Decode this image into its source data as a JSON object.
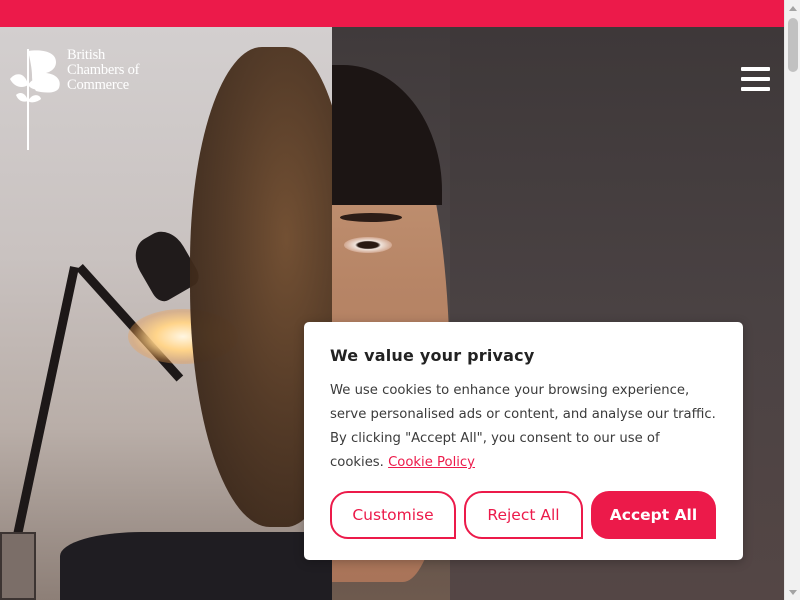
{
  "brand": {
    "name_line1": "British",
    "name_line2": "Chambers of",
    "name_line3": "Commerce",
    "accent_color": "#ec1a4a"
  },
  "header": {
    "menu_icon": "hamburger-menu-icon"
  },
  "cookie_banner": {
    "title": "We value your privacy",
    "body": "We use cookies to enhance your browsing experience, serve personalised ads or content, and analyse our traffic. By clicking \"Accept All\", you consent to our use of cookies.",
    "link_label": "Cookie Policy",
    "buttons": {
      "customise": "Customise",
      "reject": "Reject All",
      "accept": "Accept All"
    }
  }
}
